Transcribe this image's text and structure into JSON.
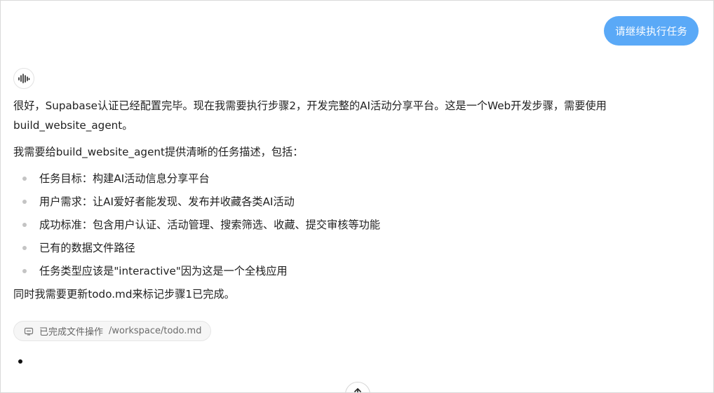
{
  "user_message": {
    "text": "请继续执行任务",
    "bubble_color": "#5aa9f7"
  },
  "assistant": {
    "avatar_icon": "waveform-icon",
    "paragraph1": "很好，Supabase认证已经配置完毕。现在我需要执行步骤2，开发完整的AI活动分享平台。这是一个Web开发步骤，需要使用build_website_agent。",
    "paragraph2": "我需要给build_website_agent提供清晰的任务描述，包括：",
    "list": [
      "任务目标：构建AI活动信息分享平台",
      "用户需求：让AI爱好者能发现、发布并收藏各类AI活动",
      "成功标准：包含用户认证、活动管理、搜索筛选、收藏、提交审核等功能",
      "已有的数据文件路径",
      "任务类型应该是\"interactive\"因为这是一个全栈应用"
    ],
    "paragraph3": "同时我需要更新todo.md来标记步骤1已完成。"
  },
  "tool_chip": {
    "icon": "file-edit-icon",
    "label": "已完成文件操作",
    "path": "/workspace/todo.md"
  },
  "scroll_button": {
    "icon": "arrow-up-icon"
  }
}
